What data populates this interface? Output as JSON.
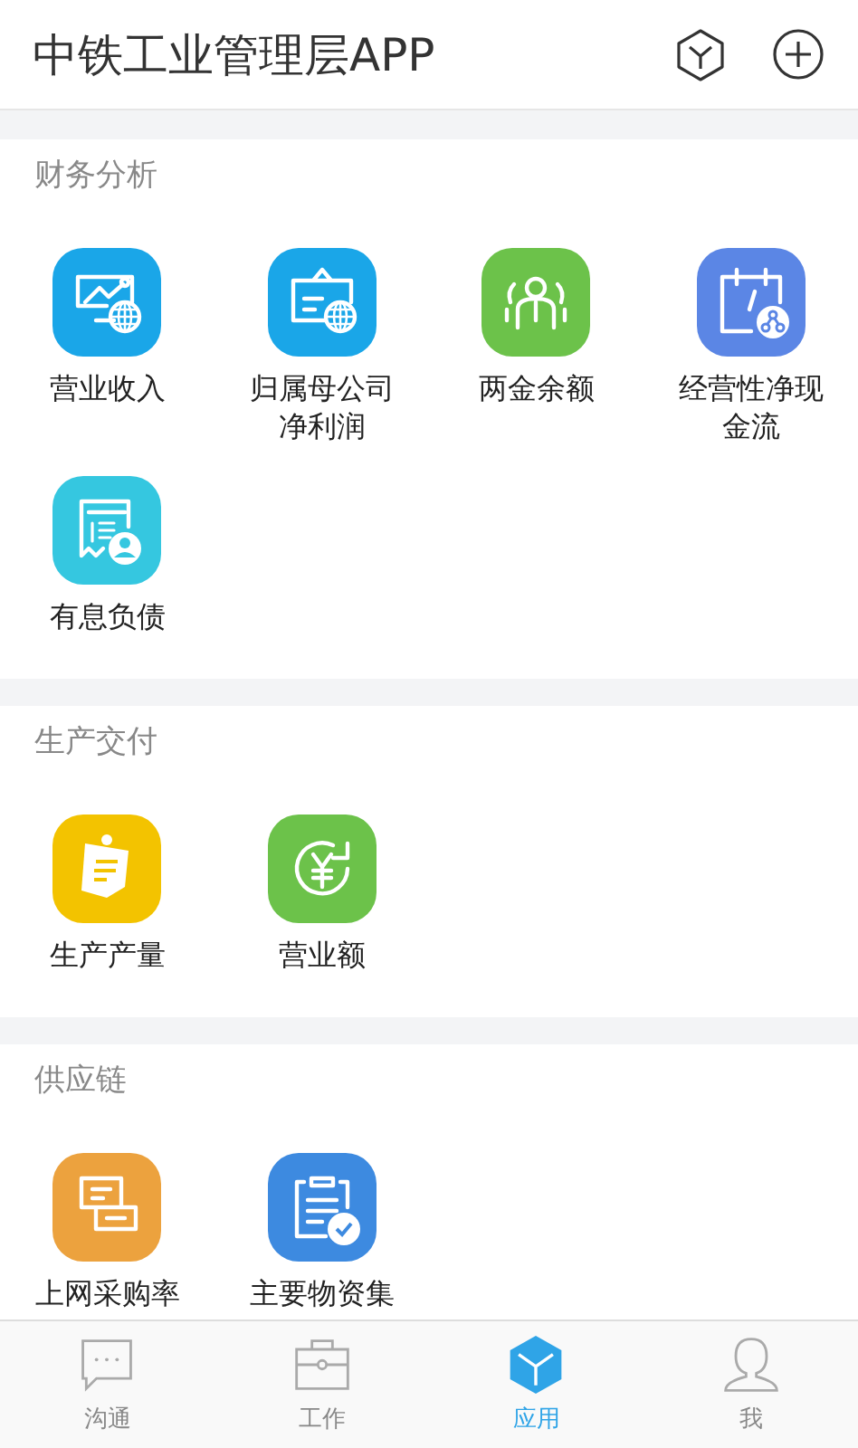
{
  "header": {
    "title": "中铁工业管理层APP"
  },
  "sections": [
    {
      "title": "财务分析",
      "items": [
        {
          "label": "营业收入",
          "kind": "chart-globe"
        },
        {
          "label": "归属母公司净利润",
          "kind": "board-globe"
        },
        {
          "label": "两金余额",
          "kind": "people"
        },
        {
          "label": "经营性净现金流",
          "kind": "calendar-share"
        },
        {
          "label": "有息负债",
          "kind": "loan"
        }
      ]
    },
    {
      "title": "生产交付",
      "items": [
        {
          "label": "生产产量",
          "kind": "notes"
        },
        {
          "label": "营业额",
          "kind": "yen-cycle"
        }
      ]
    },
    {
      "title": "供应链",
      "items": [
        {
          "label": "上网采购率",
          "kind": "documents"
        },
        {
          "label": "主要物资集",
          "kind": "clipboard-check"
        }
      ]
    }
  ],
  "tabs": [
    {
      "label": "沟通",
      "kind": "chat",
      "selected": false
    },
    {
      "label": "工作",
      "kind": "briefcase",
      "selected": false
    },
    {
      "label": "应用",
      "kind": "cube",
      "selected": true
    },
    {
      "label": "我",
      "kind": "person",
      "selected": false
    }
  ]
}
